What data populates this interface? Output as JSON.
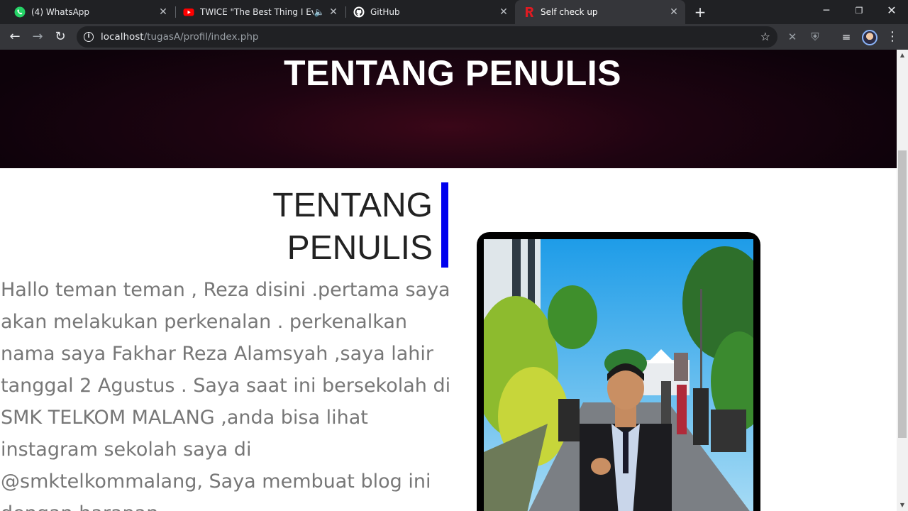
{
  "tabs": [
    {
      "title": "(4) WhatsApp",
      "icon": "whatsapp-icon",
      "color": "#25d366"
    },
    {
      "title": "TWICE \"The Best Thing I Ever",
      "icon": "youtube-icon",
      "color": "#ff0000"
    },
    {
      "title": "GitHub",
      "icon": "github-icon",
      "color": "#ffffff"
    },
    {
      "title": "Self check up",
      "icon": "r-logo-icon",
      "color": "#e01b22",
      "active": true
    }
  ],
  "toolbar": {
    "url_host": "localhost",
    "url_path": "/tugasA/profil/index.php"
  },
  "page": {
    "hero_title": "TENTANG PENULIS",
    "section_title_line1": "TENTANG",
    "section_title_line2": "PENULIS",
    "bio": "Hallo teman teman , Reza disini .pertama saya akan melakukan perkenalan . perkenalkan nama saya Fakhar Reza Alamsyah ,saya lahir tanggal 2 Agustus . Saya saat ini bersekolah di SMK TELKOM MALANG ,anda bisa lihat instagram sekolah saya di @smktelkommalang, Saya membuat blog ini dengan harapan",
    "accent_color": "#0000ee"
  }
}
